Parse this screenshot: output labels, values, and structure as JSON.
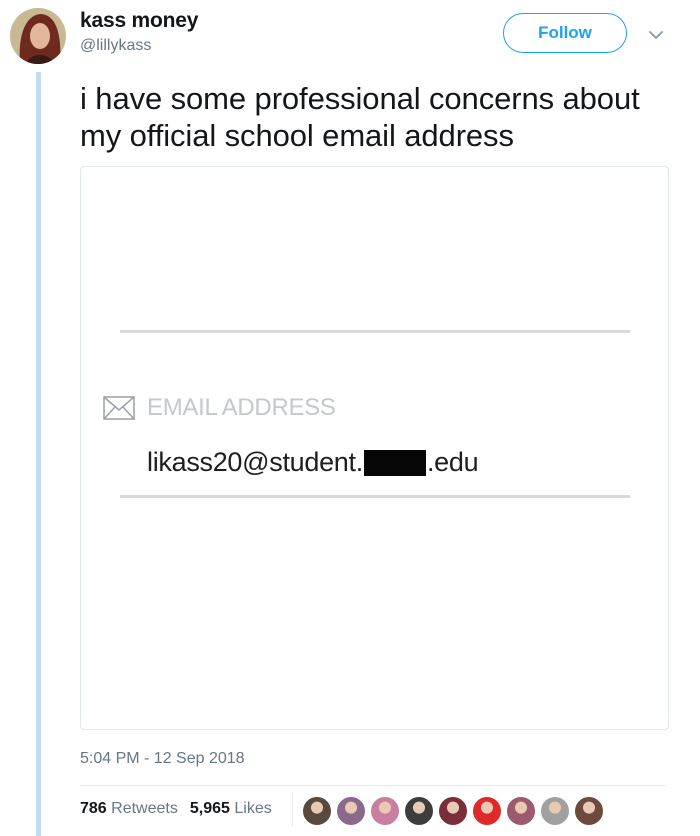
{
  "author": {
    "display_name": "kass money",
    "handle": "@lillykass"
  },
  "follow_label": "Follow",
  "tweet": {
    "text": "i have some professional concerns about my official school email address"
  },
  "media": {
    "email_label": "EMAIL ADDRESS",
    "email_prefix": "likass20@student.",
    "email_suffix": ".edu"
  },
  "timestamp": "5:04 PM - 12 Sep 2018",
  "stats": {
    "retweets_count": "786",
    "retweets_label": "Retweets",
    "likes_count": "5,965",
    "likes_label": "Likes"
  },
  "likers": [
    {
      "name": "liker-avatar-1",
      "color": "#5a4a3e"
    },
    {
      "name": "liker-avatar-2",
      "color": "#8a6a8c"
    },
    {
      "name": "liker-avatar-3",
      "color": "#c97fa0"
    },
    {
      "name": "liker-avatar-4",
      "color": "#3d3d3d"
    },
    {
      "name": "liker-avatar-5",
      "color": "#7a2e3a"
    },
    {
      "name": "liker-avatar-6",
      "color": "#e02a2a"
    },
    {
      "name": "liker-avatar-7",
      "color": "#9c5a6e"
    },
    {
      "name": "liker-avatar-8",
      "color": "#a0a0a0"
    },
    {
      "name": "liker-avatar-9",
      "color": "#6b4b3e"
    }
  ],
  "colors": {
    "accent": "#1da1f2",
    "thread_line": "#c4dcef",
    "muted_text": "#657786"
  }
}
